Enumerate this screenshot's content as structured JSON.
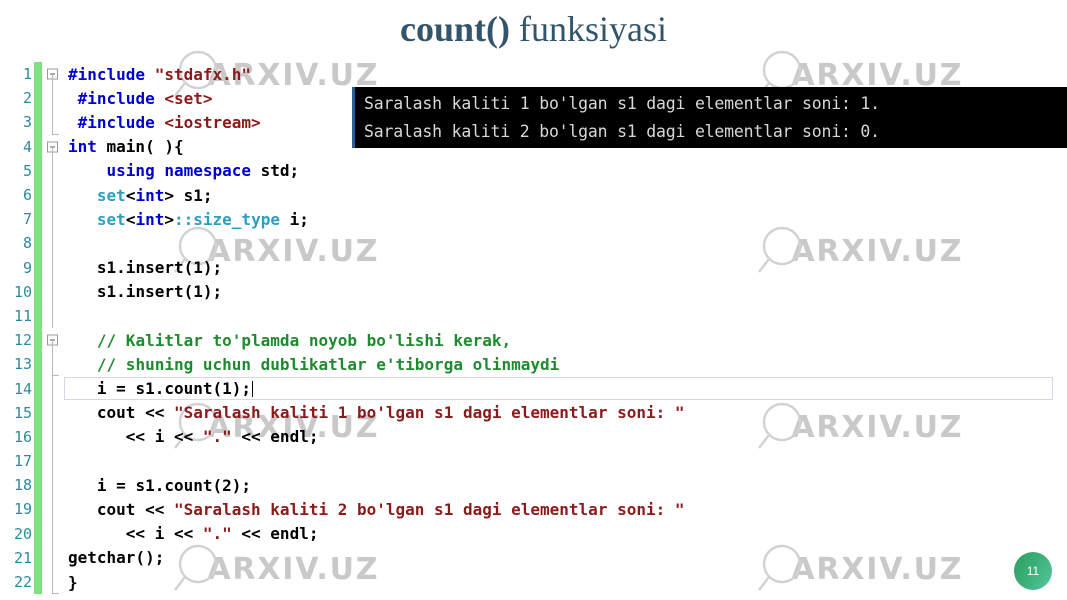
{
  "title": {
    "bold_part": "count()",
    "normal_part": " funksiyasi"
  },
  "watermark": {
    "text": "ARXIV.UZ",
    "icon": "magnifier-icon"
  },
  "console": {
    "lines": [
      "Saralash kaliti 1 bo'lgan s1 dagi elementlar soni: 1.",
      "Saralash kaliti 2 bo'lgan s1 dagi elementlar soni: 0."
    ]
  },
  "page_badge": {
    "number": "11"
  },
  "colors": {
    "title": "#33556b",
    "change_bar": "#7fe07f",
    "line_number": "#2e8b9e",
    "keyword": "#0000d0",
    "string": "#8b1a1a",
    "type": "#2e9ec4",
    "comment": "#1f8b2f",
    "console_bg": "#000000",
    "console_fg": "#d8d8d8",
    "badge": "#3bae77"
  },
  "editor": {
    "lines": [
      {
        "n": "1",
        "fold": "box",
        "tree": "none",
        "tokens": [
          {
            "t": "#include ",
            "c": "tok-pre"
          },
          {
            "t": "\"stdafx.h\"",
            "c": "tok-str"
          }
        ]
      },
      {
        "n": "2",
        "fold": "none",
        "tree": "full",
        "indent": 1,
        "tokens": [
          {
            "t": "#include ",
            "c": "tok-pre"
          },
          {
            "t": "<set>",
            "c": "tok-str"
          }
        ]
      },
      {
        "n": "3",
        "fold": "none",
        "tree": "endcap",
        "indent": 1,
        "tokens": [
          {
            "t": "#include ",
            "c": "tok-pre"
          },
          {
            "t": "<iostream>",
            "c": "tok-str"
          }
        ]
      },
      {
        "n": "4",
        "fold": "box",
        "tree": "none",
        "tokens": [
          {
            "t": "int ",
            "c": "tok-kw"
          },
          {
            "t": "main( ){",
            "c": "tok-plain"
          }
        ]
      },
      {
        "n": "5",
        "fold": "none",
        "tree": "full",
        "indent": 4,
        "tokens": [
          {
            "t": "using namespace ",
            "c": "tok-pre"
          },
          {
            "t": "std;",
            "c": "tok-plain"
          }
        ]
      },
      {
        "n": "6",
        "fold": "none",
        "tree": "full",
        "indent": 3,
        "tokens": [
          {
            "t": "set",
            "c": "tok-type"
          },
          {
            "t": "<",
            "c": "tok-plain"
          },
          {
            "t": "int",
            "c": "tok-kw"
          },
          {
            "t": "> ",
            "c": "tok-plain"
          },
          {
            "t": "s1;",
            "c": "tok-plain"
          }
        ]
      },
      {
        "n": "7",
        "fold": "none",
        "tree": "full",
        "indent": 3,
        "tokens": [
          {
            "t": "set",
            "c": "tok-type"
          },
          {
            "t": "<",
            "c": "tok-plain"
          },
          {
            "t": "int",
            "c": "tok-kw"
          },
          {
            "t": ">",
            "c": "tok-plain"
          },
          {
            "t": "::",
            "c": "tok-type"
          },
          {
            "t": "size_type",
            "c": "tok-type"
          },
          {
            "t": " i;",
            "c": "tok-plain"
          }
        ]
      },
      {
        "n": "8",
        "fold": "none",
        "tree": "full",
        "indent": 0,
        "tokens": []
      },
      {
        "n": "9",
        "fold": "none",
        "tree": "full",
        "indent": 3,
        "tokens": [
          {
            "t": "s1.insert(1);",
            "c": "tok-plain"
          }
        ]
      },
      {
        "n": "10",
        "fold": "none",
        "tree": "full",
        "indent": 3,
        "tokens": [
          {
            "t": "s1.insert(1);",
            "c": "tok-plain"
          }
        ]
      },
      {
        "n": "11",
        "fold": "none",
        "tree": "full",
        "indent": 0,
        "tokens": []
      },
      {
        "n": "12",
        "fold": "box",
        "tree": "none",
        "indent": 3,
        "tokens": [
          {
            "t": "// Kalitlar to'plamda noyob bo'lishi kerak,",
            "c": "tok-cmt"
          }
        ]
      },
      {
        "n": "13",
        "fold": "none",
        "tree": "endcap",
        "indent": 3,
        "tokens": [
          {
            "t": "// shuning uchun dublikatlar e'tiborga olinmaydi",
            "c": "tok-cmt"
          }
        ]
      },
      {
        "n": "14",
        "fold": "none",
        "tree": "full",
        "indent": 3,
        "current": true,
        "tokens": [
          {
            "t": "i = s1.count(1);",
            "c": "tok-plain"
          }
        ]
      },
      {
        "n": "15",
        "fold": "none",
        "tree": "full",
        "indent": 3,
        "tokens": [
          {
            "t": "cout << ",
            "c": "tok-plain"
          },
          {
            "t": "\"Saralash kaliti 1 bo'lgan s1 dagi elementlar soni: \"",
            "c": "tok-str"
          }
        ]
      },
      {
        "n": "16",
        "fold": "none",
        "tree": "full",
        "indent": 6,
        "tokens": [
          {
            "t": "<< i << ",
            "c": "tok-plain"
          },
          {
            "t": "\".\"",
            "c": "tok-str"
          },
          {
            "t": " << endl;",
            "c": "tok-plain"
          }
        ]
      },
      {
        "n": "17",
        "fold": "none",
        "tree": "full",
        "indent": 0,
        "tokens": []
      },
      {
        "n": "18",
        "fold": "none",
        "tree": "full",
        "indent": 3,
        "tokens": [
          {
            "t": "i = s1.count(2);",
            "c": "tok-plain"
          }
        ]
      },
      {
        "n": "19",
        "fold": "none",
        "tree": "full",
        "indent": 3,
        "tokens": [
          {
            "t": "cout << ",
            "c": "tok-plain"
          },
          {
            "t": "\"Saralash kaliti 2 bo'lgan s1 dagi elementlar soni: \"",
            "c": "tok-str"
          }
        ]
      },
      {
        "n": "20",
        "fold": "none",
        "tree": "full",
        "indent": 6,
        "tokens": [
          {
            "t": "<< i << ",
            "c": "tok-plain"
          },
          {
            "t": "\".\"",
            "c": "tok-str"
          },
          {
            "t": " << endl;",
            "c": "tok-plain"
          }
        ]
      },
      {
        "n": "21",
        "fold": "none",
        "tree": "full",
        "indent": 0,
        "tokens": [
          {
            "t": "getchar();",
            "c": "tok-plain"
          }
        ]
      },
      {
        "n": "22",
        "fold": "none",
        "tree": "endcap",
        "indent": 0,
        "tokens": [
          {
            "t": "}",
            "c": "tok-plain"
          }
        ]
      }
    ]
  }
}
